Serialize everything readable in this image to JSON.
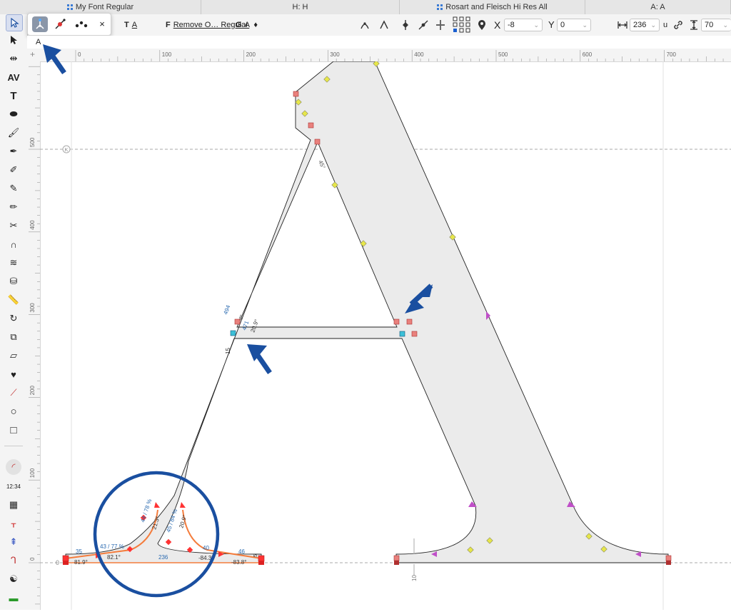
{
  "tabs": [
    {
      "label": "My Font Regular",
      "has_grid_icon": true,
      "width": 282
    },
    {
      "label": "H: H",
      "has_grid_icon": false,
      "width": 278
    },
    {
      "label": "Rosart and Fleisch Hi Res All",
      "has_grid_icon": true,
      "width": 260
    },
    {
      "label": "A: A",
      "has_grid_icon": false,
      "width": 204
    }
  ],
  "toolbar": {
    "t_field": "A",
    "f_label": "F",
    "font_select": "Remove O… Regular",
    "g_label": "G",
    "g_field": "A",
    "x_label": "X",
    "x_value": "-8",
    "y_label": "Y",
    "y_value": "0",
    "width_value": "236",
    "width_unit": "u",
    "height_value": "70"
  },
  "popup": {
    "close_label": "×"
  },
  "glyph_name": "A",
  "ruler": {
    "h_ticks": [
      "0",
      "100",
      "200",
      "300",
      "400",
      "500",
      "600",
      "700"
    ],
    "v_ticks": [
      "500",
      "400",
      "300",
      "200",
      "100",
      "0"
    ]
  },
  "measurements": {
    "ang_left_stem": "45°",
    "bar_len_a": "494",
    "bar_len_b": "471",
    "bar_angle": "20.9°",
    "bar_angle2": "2°",
    "bar_thickness": "15",
    "serif_l1": "44 / 78 %",
    "serif_l1_ang": "21.3°",
    "serif_r1": "45 / 84 %",
    "serif_r1_ang": "20.9°",
    "foot_l": "35",
    "foot_l_ang": "81.9°",
    "foot_l2": "43 / 77 %",
    "foot_l2_ang": "82.1°",
    "foot_r": "40",
    "foot_r_ang": "-84.3°",
    "foot_r2": "46",
    "foot_r2_ang": "-83.8°",
    "foot_width": "236",
    "foot_right_label": "5",
    "base_gap": "10",
    "asc_marker": "K"
  },
  "colors": {
    "accent": "#1a4fa0",
    "orange": "#f47c3c",
    "node_red": "#e9817d",
    "node_yellow": "#e6e64a",
    "node_magenta": "#c050c8",
    "node_cyan": "#3cc0d8",
    "glyph_fill": "#ebebeb"
  }
}
